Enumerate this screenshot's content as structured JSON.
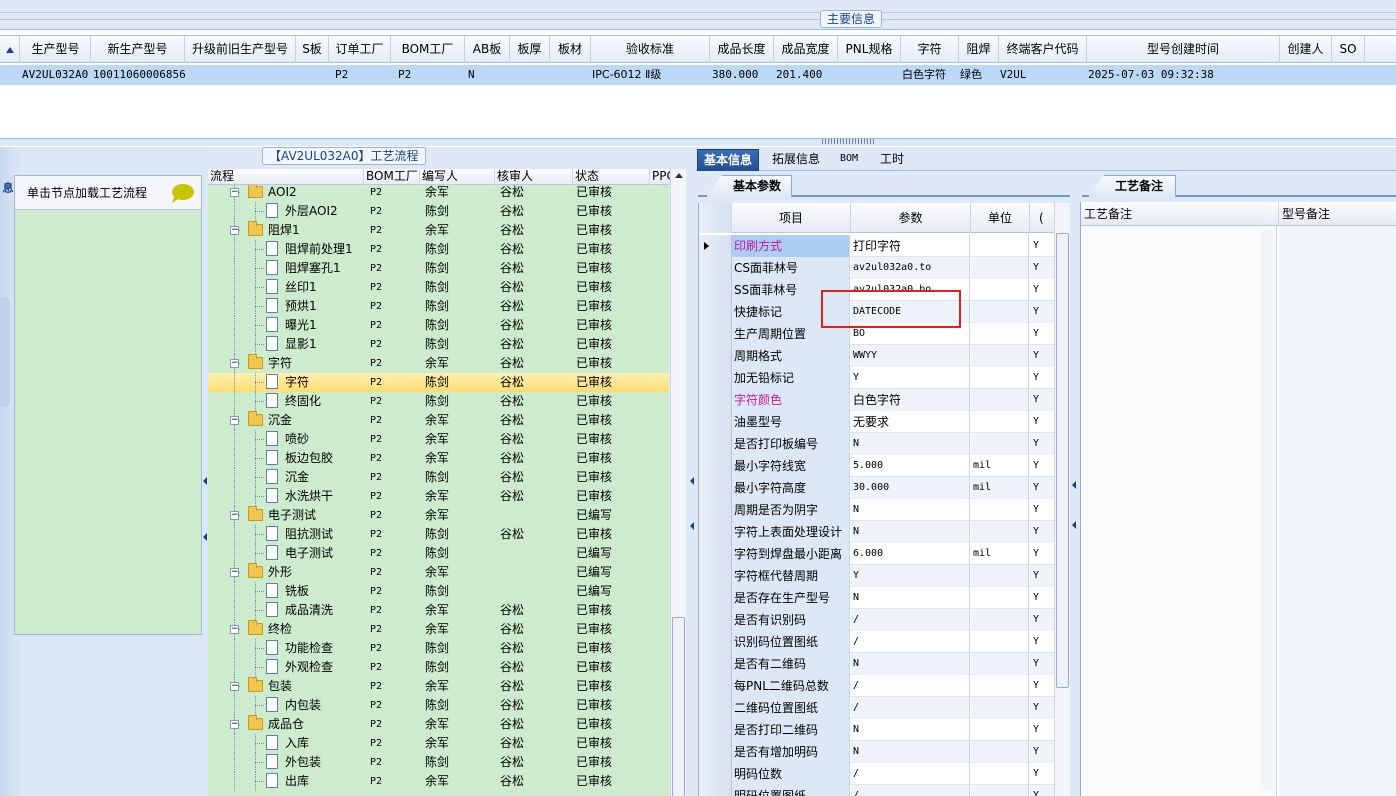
{
  "main_info": {
    "title": "主要信息",
    "columns": [
      "生产型号",
      "新生产型号",
      "升级前旧生产型号",
      "S板",
      "订单工厂",
      "BOM工厂",
      "AB板",
      "板厚",
      "板材",
      "验收标准",
      "成品长度",
      "成品宽度",
      "PNL规格",
      "字符",
      "阻焊",
      "终端客户代码",
      "型号创建时间",
      "创建人",
      "SO"
    ],
    "row": {
      "prod_model": "AV2UL032A0",
      "new_prod_model": "10011060006856",
      "order_factory": "P2",
      "bom_factory": "P2",
      "ab_board": "N",
      "standard": "IPC-6012 Ⅱ级",
      "length": "380.000",
      "width": "201.400",
      "char": "白色字符",
      "solder": "绿色",
      "customer": "V2UL",
      "created": "2025-07-03 09:32:38"
    }
  },
  "left_panel": {
    "load_btn": "单击节点加载工艺流程",
    "vtab": "导航信息"
  },
  "process_tree": {
    "title": "【AV2UL032A0】工艺流程",
    "headers": [
      "流程",
      "BOM工厂",
      "编写人",
      "核审人",
      "状态",
      "PPC"
    ],
    "rows": [
      {
        "name": "AOI2",
        "f": "P2",
        "w": "余军",
        "r": "谷松",
        "s": "已审核",
        "lvl": 0
      },
      {
        "name": "外层AOI2",
        "f": "P2",
        "w": "陈剑",
        "r": "谷松",
        "s": "已审核",
        "lvl": 1
      },
      {
        "name": "阻焊1",
        "f": "P2",
        "w": "余军",
        "r": "谷松",
        "s": "已审核",
        "lvl": 0
      },
      {
        "name": "阻焊前处理1",
        "f": "P2",
        "w": "陈剑",
        "r": "谷松",
        "s": "已审核",
        "lvl": 1
      },
      {
        "name": "阻焊塞孔1",
        "f": "P2",
        "w": "陈剑",
        "r": "谷松",
        "s": "已审核",
        "lvl": 1
      },
      {
        "name": "丝印1",
        "f": "P2",
        "w": "陈剑",
        "r": "谷松",
        "s": "已审核",
        "lvl": 1
      },
      {
        "name": "预烘1",
        "f": "P2",
        "w": "陈剑",
        "r": "谷松",
        "s": "已审核",
        "lvl": 1
      },
      {
        "name": "曝光1",
        "f": "P2",
        "w": "陈剑",
        "r": "谷松",
        "s": "已审核",
        "lvl": 1
      },
      {
        "name": "显影1",
        "f": "P2",
        "w": "陈剑",
        "r": "谷松",
        "s": "已审核",
        "lvl": 1
      },
      {
        "name": "字符",
        "f": "P2",
        "w": "余军",
        "r": "谷松",
        "s": "已审核",
        "lvl": 0
      },
      {
        "name": "字符",
        "f": "P2",
        "w": "陈剑",
        "r": "谷松",
        "s": "已审核",
        "lvl": 1,
        "sel": true
      },
      {
        "name": "终固化",
        "f": "P2",
        "w": "陈剑",
        "r": "谷松",
        "s": "已审核",
        "lvl": 1
      },
      {
        "name": "沉金",
        "f": "P2",
        "w": "余军",
        "r": "谷松",
        "s": "已审核",
        "lvl": 0
      },
      {
        "name": "喷砂",
        "f": "P2",
        "w": "余军",
        "r": "谷松",
        "s": "已审核",
        "lvl": 1
      },
      {
        "name": "板边包胶",
        "f": "P2",
        "w": "余军",
        "r": "谷松",
        "s": "已审核",
        "lvl": 1
      },
      {
        "name": "沉金",
        "f": "P2",
        "w": "陈剑",
        "r": "谷松",
        "s": "已审核",
        "lvl": 1
      },
      {
        "name": "水洗烘干",
        "f": "P2",
        "w": "余军",
        "r": "谷松",
        "s": "已审核",
        "lvl": 1
      },
      {
        "name": "电子测试",
        "f": "P2",
        "w": "余军",
        "r": "",
        "s": "已编写",
        "lvl": 0
      },
      {
        "name": "阻抗测试",
        "f": "P2",
        "w": "陈剑",
        "r": "谷松",
        "s": "已审核",
        "lvl": 1
      },
      {
        "name": "电子测试",
        "f": "P2",
        "w": "陈剑",
        "r": "",
        "s": "已编写",
        "lvl": 1
      },
      {
        "name": "外形",
        "f": "P2",
        "w": "余军",
        "r": "",
        "s": "已编写",
        "lvl": 0
      },
      {
        "name": "铣板",
        "f": "P2",
        "w": "陈剑",
        "r": "",
        "s": "已编写",
        "lvl": 1
      },
      {
        "name": "成品清洗",
        "f": "P2",
        "w": "余军",
        "r": "谷松",
        "s": "已审核",
        "lvl": 1
      },
      {
        "name": "终检",
        "f": "P2",
        "w": "余军",
        "r": "谷松",
        "s": "已审核",
        "lvl": 0
      },
      {
        "name": "功能检查",
        "f": "P2",
        "w": "陈剑",
        "r": "谷松",
        "s": "已审核",
        "lvl": 1
      },
      {
        "name": "外观检查",
        "f": "P2",
        "w": "陈剑",
        "r": "谷松",
        "s": "已审核",
        "lvl": 1
      },
      {
        "name": "包装",
        "f": "P2",
        "w": "余军",
        "r": "谷松",
        "s": "已审核",
        "lvl": 0
      },
      {
        "name": "内包装",
        "f": "P2",
        "w": "陈剑",
        "r": "谷松",
        "s": "已审核",
        "lvl": 1
      },
      {
        "name": "成品仓",
        "f": "P2",
        "w": "余军",
        "r": "谷松",
        "s": "已审核",
        "lvl": 0
      },
      {
        "name": "入库",
        "f": "P2",
        "w": "余军",
        "r": "谷松",
        "s": "已审核",
        "lvl": 1
      },
      {
        "name": "外包装",
        "f": "P2",
        "w": "陈剑",
        "r": "谷松",
        "s": "已审核",
        "lvl": 1
      },
      {
        "name": "出库",
        "f": "P2",
        "w": "余军",
        "r": "谷松",
        "s": "已审核",
        "lvl": 1
      }
    ]
  },
  "detail": {
    "tabs": [
      "基本信息",
      "拓展信息",
      "BOM",
      "工时"
    ],
    "basic_params_title": "基本参数",
    "headers": [
      "项目",
      "参数",
      "单位",
      "("
    ],
    "rows": [
      {
        "item": "印刷方式",
        "val": "打印字符",
        "unit": "",
        "flag": "Y",
        "pink": true,
        "sel": true
      },
      {
        "item": "CS面菲林号",
        "val": "av2ul032a0.to",
        "unit": "",
        "flag": "Y"
      },
      {
        "item": "SS面菲林号",
        "val": "av2ul032a0.bo",
        "unit": "",
        "flag": "Y"
      },
      {
        "item": "快捷标记",
        "val": "DATECODE",
        "unit": "",
        "flag": "Y"
      },
      {
        "item": "生产周期位置",
        "val": "BO",
        "unit": "",
        "flag": "Y"
      },
      {
        "item": "周期格式",
        "val": "WWYY",
        "unit": "",
        "flag": "Y"
      },
      {
        "item": "加无铅标记",
        "val": "Y",
        "unit": "",
        "flag": "Y"
      },
      {
        "item": "字符颜色",
        "val": "白色字符",
        "unit": "",
        "flag": "Y",
        "pink": true
      },
      {
        "item": "油墨型号",
        "val": "无要求",
        "unit": "",
        "flag": "Y"
      },
      {
        "item": "是否打印板编号",
        "val": "N",
        "unit": "",
        "flag": "Y"
      },
      {
        "item": "最小字符线宽",
        "val": "5.000",
        "unit": "mil",
        "flag": "Y"
      },
      {
        "item": "最小字符高度",
        "val": "30.000",
        "unit": "mil",
        "flag": "Y"
      },
      {
        "item": "周期是否为阴字",
        "val": "N",
        "unit": "",
        "flag": "Y"
      },
      {
        "item": "字符上表面处理设计",
        "val": "N",
        "unit": "",
        "flag": "Y"
      },
      {
        "item": "字符到焊盘最小距离",
        "val": "6.000",
        "unit": "mil",
        "flag": "Y"
      },
      {
        "item": "字符框代替周期",
        "val": "Y",
        "unit": "",
        "flag": "Y"
      },
      {
        "item": "是否存在生产型号",
        "val": "N",
        "unit": "",
        "flag": "Y"
      },
      {
        "item": "是否有识别码",
        "val": "/",
        "unit": "",
        "flag": "Y"
      },
      {
        "item": "识别码位置图纸",
        "val": "/",
        "unit": "",
        "flag": "Y"
      },
      {
        "item": "是否有二维码",
        "val": "N",
        "unit": "",
        "flag": "Y"
      },
      {
        "item": "每PNL二维码总数",
        "val": "/",
        "unit": "",
        "flag": "Y"
      },
      {
        "item": "二维码位置图纸",
        "val": "/",
        "unit": "",
        "flag": "Y"
      },
      {
        "item": "是否打印二维码",
        "val": "N",
        "unit": "",
        "flag": "Y"
      },
      {
        "item": "是否有增加明码",
        "val": "N",
        "unit": "",
        "flag": "Y"
      },
      {
        "item": "明码位数",
        "val": "/",
        "unit": "",
        "flag": "Y"
      },
      {
        "item": "明码位置图纸",
        "val": "/",
        "unit": "",
        "flag": "Y"
      }
    ]
  },
  "remarks": {
    "title": "工艺备注",
    "col1": "工艺备注",
    "col2": "型号备注"
  },
  "colors": {
    "accent": "#1f4d96",
    "tree_bg": "#cdebcd",
    "highlight": "#e02020",
    "pink": "#c2189c"
  }
}
